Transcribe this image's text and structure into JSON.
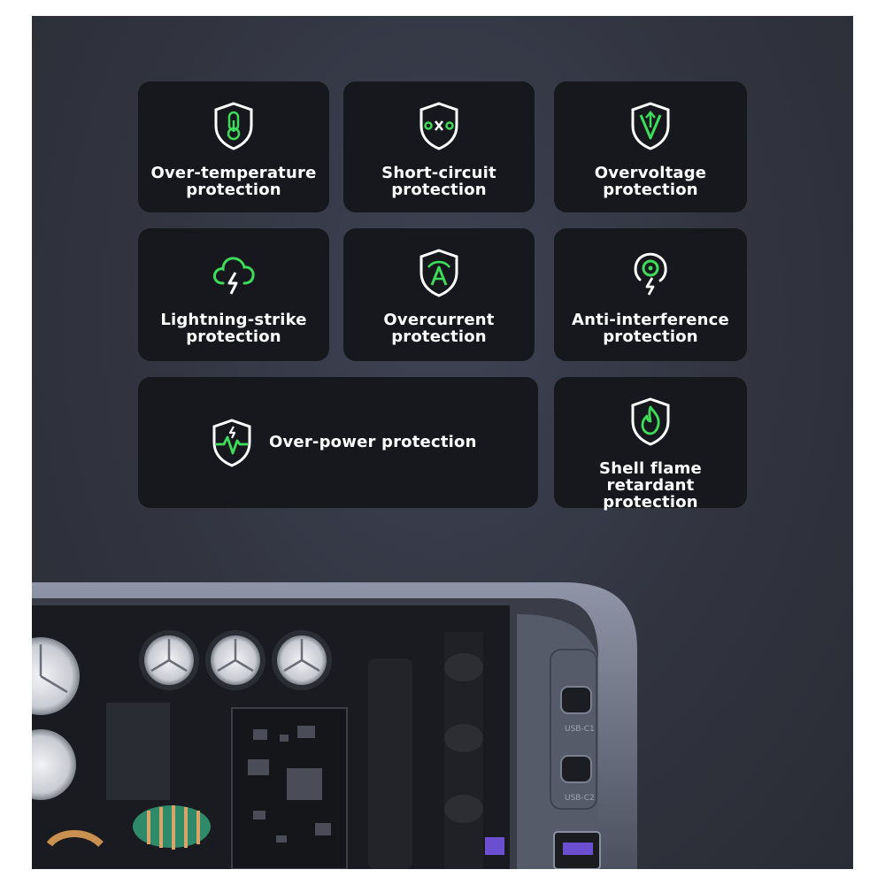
{
  "features": [
    {
      "line1": "Over-temperature",
      "line2": "protection",
      "icon": "thermometer-shield-icon"
    },
    {
      "line1": "Short-circuit",
      "line2": "protection",
      "icon": "short-circuit-shield-icon"
    },
    {
      "line1": "Overvoltage",
      "line2": "protection",
      "icon": "voltage-shield-icon"
    },
    {
      "line1": "Lightning-strike",
      "line2": "protection",
      "icon": "lightning-cloud-icon"
    },
    {
      "line1": "Overcurrent",
      "line2": "protection",
      "icon": "current-shield-icon"
    },
    {
      "line1": "Anti-interference",
      "line2": "protection",
      "icon": "interference-target-icon"
    },
    {
      "line1": "Over-power protection",
      "line2": "",
      "icon": "pulse-shield-icon"
    },
    {
      "line1": "Shell flame retardant",
      "line2": "protection",
      "icon": "flame-shield-icon"
    }
  ],
  "device": {
    "port1_label": "USB-C1",
    "port2_label": "USB-C2"
  },
  "colors": {
    "accent": "#3ddc5a",
    "card": "#17181d",
    "background": "#31343f"
  }
}
